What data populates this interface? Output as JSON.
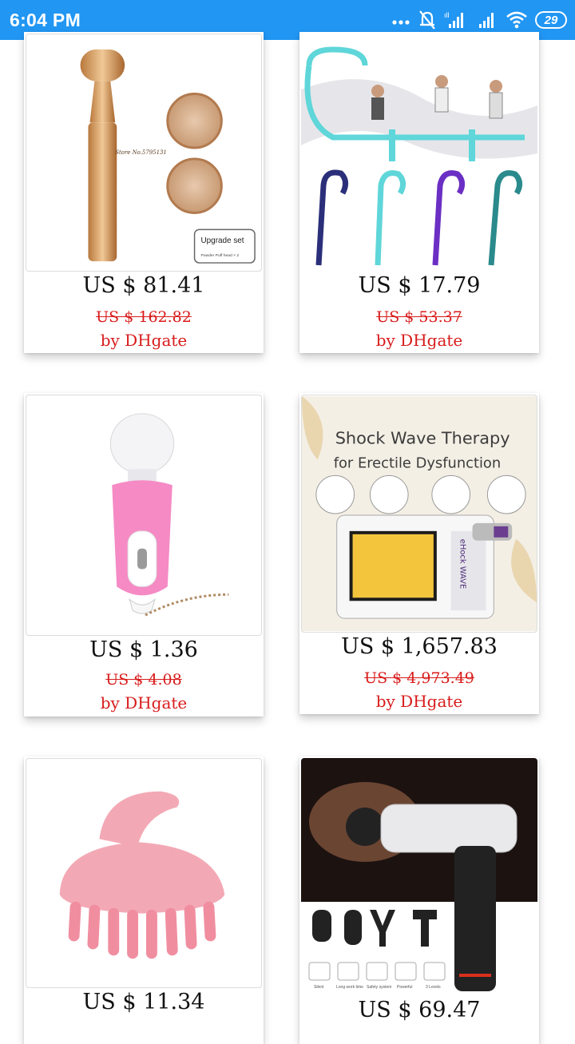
{
  "status_bar": {
    "time": "6:04 PM",
    "battery": "29"
  },
  "products": [
    {
      "price": "US $ 81.41",
      "old_price": "US $ 162.82",
      "seller": "by DHgate",
      "image_text": [
        "Store No.5795131",
        "Upgrade set",
        "Powder Puff head × 2"
      ]
    },
    {
      "price": "US $ 17.79",
      "old_price": "US $ 53.37",
      "seller": "by DHgate",
      "image_text": []
    },
    {
      "price": "US $ 1.36",
      "old_price": "US $ 4.08",
      "seller": "by DHgate",
      "image_text": []
    },
    {
      "price": "US $ 1,657.83",
      "old_price": "US $ 4,973.49",
      "seller": "by DHgate",
      "image_text": [
        "Shock Wave Therapy",
        "for Erectile Dysfunction",
        "eHock WAVE"
      ]
    },
    {
      "price": "US $ 11.34",
      "image_text": []
    },
    {
      "price": "US $ 69.47",
      "image_text": [
        "Silent",
        "Long work time",
        "Safety system",
        "Powerful",
        "3 Levels"
      ]
    }
  ],
  "colors": {
    "status_bar": "#2196f3",
    "discount_red": "#d81b1b"
  }
}
